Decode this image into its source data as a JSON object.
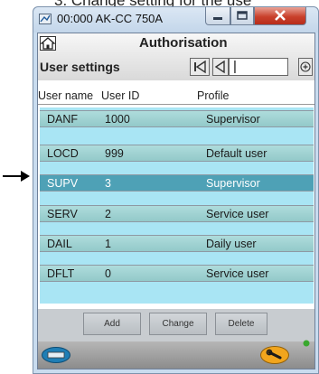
{
  "caption_text": "3. Change setting for the use",
  "window": {
    "title": "00:000 AK-CC 750A",
    "minimize_glyph": "—",
    "maximize_glyph": "☐",
    "close_glyph": "✕"
  },
  "header": {
    "title": "Authorisation",
    "section": "User settings",
    "first_glyph": "|◄",
    "prev_glyph": "◄",
    "next_glyph": "+",
    "page_value": "|"
  },
  "columns": {
    "name": "User name",
    "id": "User ID",
    "profile": "Profile"
  },
  "users": [
    {
      "name": "DANF",
      "id": "1000",
      "profile": "Supervisor"
    },
    {
      "name": "LOCD",
      "id": "999",
      "profile": "Default user"
    },
    {
      "name": "SUPV",
      "id": "3",
      "profile": "Supervisor"
    },
    {
      "name": "SERV",
      "id": "2",
      "profile": "Service user"
    },
    {
      "name": "DAIL",
      "id": "1",
      "profile": "Daily user"
    },
    {
      "name": "DFLT",
      "id": "0",
      "profile": "Service user"
    }
  ],
  "actions": {
    "add": "Add",
    "change": "Change",
    "delete": "Delete"
  },
  "colors": {
    "list_bg": "#a9e5f4",
    "row_bg": "#9fd2d2",
    "selected_row": "#4ea1b6",
    "close_button": "#c9412c"
  },
  "icons": [
    "arrow-right-icon",
    "app-icon",
    "home-icon",
    "connection-icon",
    "wrench-icon",
    "status-led-icon"
  ]
}
